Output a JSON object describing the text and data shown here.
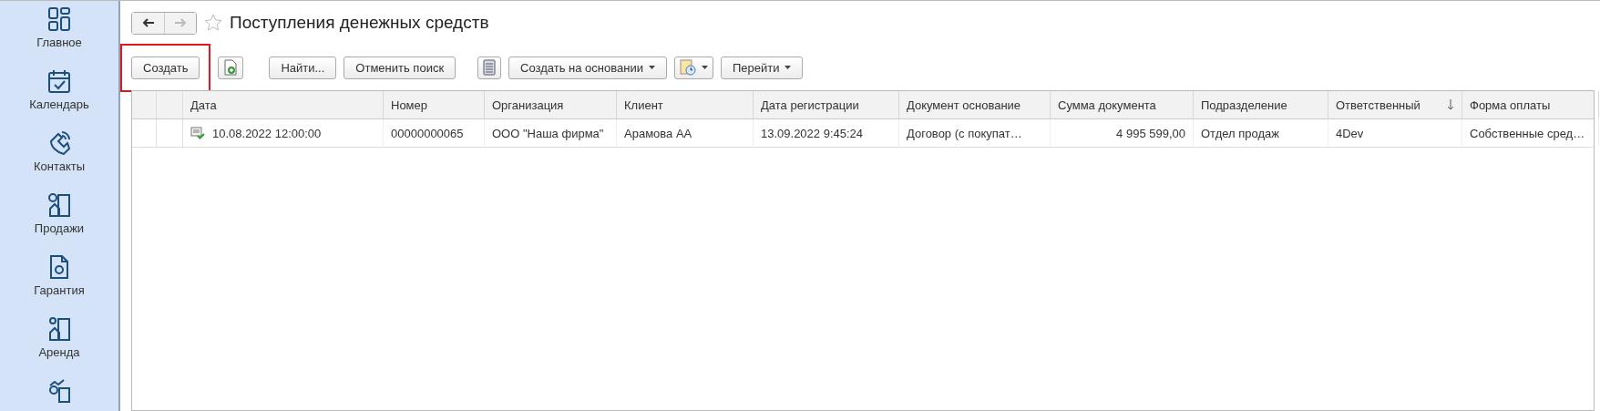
{
  "sidebar": {
    "items": [
      {
        "label": "Главное",
        "selected": false
      },
      {
        "label": "Календарь",
        "selected": false
      },
      {
        "label": "Контакты",
        "selected": false
      },
      {
        "label": "Продажи",
        "selected": false
      },
      {
        "label": "Гарантия",
        "selected": false
      },
      {
        "label": "Аренда",
        "selected": false
      },
      {
        "selected": false
      }
    ]
  },
  "title": "Поступления денежных средств",
  "favorite": false,
  "toolbar": [
    {
      "kind": "button",
      "label": "Создать",
      "highlighted": true
    },
    {
      "kind": "icon",
      "highlighted": false
    },
    {
      "kind": "button",
      "label": "Найти...",
      "highlighted": false
    },
    {
      "kind": "button",
      "label": "Отменить поиск",
      "highlighted": false
    },
    {
      "kind": "icon",
      "highlighted": false
    },
    {
      "kind": "dropdown",
      "label": "Создать на основании",
      "highlighted": false
    },
    {
      "kind": "icon-dropdown",
      "highlighted": false
    },
    {
      "kind": "dropdown",
      "label": "Перейти",
      "highlighted": false
    }
  ],
  "table": {
    "columns": [
      {
        "label": "Дата",
        "sorted": false
      },
      {
        "label": "Номер",
        "sorted": false
      },
      {
        "label": "Организация",
        "sorted": false
      },
      {
        "label": "Клиент",
        "sorted": false
      },
      {
        "label": "Дата регистрации",
        "sorted": false
      },
      {
        "label": "Документ основание",
        "sorted": false
      },
      {
        "label": "Сумма документа",
        "sorted": false
      },
      {
        "label": "Подразделение",
        "sorted": false
      },
      {
        "label": "Ответственный",
        "sorted": true
      },
      {
        "label": "Форма оплаты",
        "sorted": false
      }
    ],
    "rows": [
      {
        "posted": true,
        "selected": false,
        "cells": [
          "10.08.2022 12:00:00",
          "00000000065",
          "ООО \"Наша фирма\"",
          "Арамова АА",
          "13.09.2022 9:45:24",
          "Договор (с покупат…",
          "4 995 599,00",
          "Отдел продаж",
          "4Dev",
          "Собственные сред…"
        ]
      }
    ]
  }
}
